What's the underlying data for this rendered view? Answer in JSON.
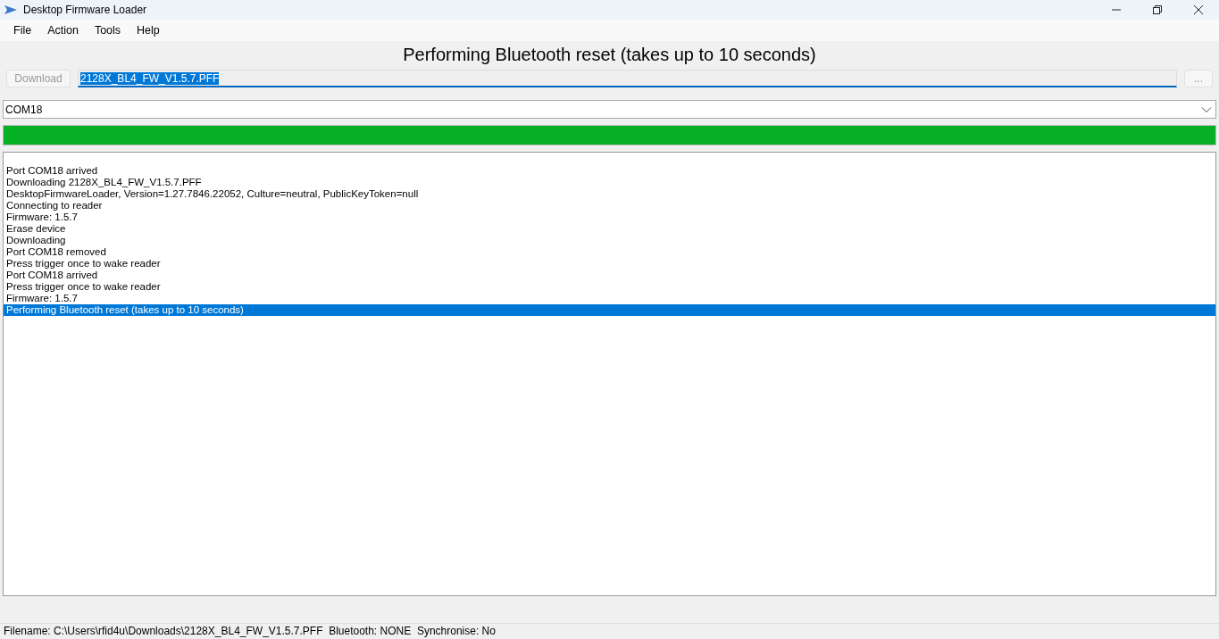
{
  "window": {
    "title": "Desktop Firmware Loader"
  },
  "menu": [
    "File",
    "Action",
    "Tools",
    "Help"
  ],
  "heading": "Performing Bluetooth reset (takes up to 10 seconds)",
  "download_button": {
    "label": "Download",
    "disabled": true
  },
  "filename_field": {
    "value": "2128X_BL4_FW_V1.5.7.PFF",
    "text_selected": true
  },
  "browse_button": {
    "label": "...",
    "disabled": true
  },
  "port_combo": {
    "value": "COM18"
  },
  "progress": {
    "level": 1.0
  },
  "log": [
    {
      "text": "Port COM18 arrived",
      "selected": false
    },
    {
      "text": "Downloading 2128X_BL4_FW_V1.5.7.PFF",
      "selected": false
    },
    {
      "text": "DesktopFirmwareLoader, Version=1.27.7846.22052, Culture=neutral, PublicKeyToken=null",
      "selected": false
    },
    {
      "text": "Connecting to reader",
      "selected": false
    },
    {
      "text": "Firmware: 1.5.7",
      "selected": false
    },
    {
      "text": "Erase device",
      "selected": false
    },
    {
      "text": "Downloading",
      "selected": false
    },
    {
      "text": "Port COM18 removed",
      "selected": false
    },
    {
      "text": "Press trigger once to wake reader",
      "selected": false
    },
    {
      "text": "Port COM18 arrived",
      "selected": false
    },
    {
      "text": "Press trigger once to wake reader",
      "selected": false
    },
    {
      "text": "Firmware: 1.5.7",
      "selected": false
    },
    {
      "text": "Performing Bluetooth reset (takes up to 10 seconds)",
      "selected": true
    }
  ],
  "status_bar": "Filename: C:\\Users\\rfid4u\\Downloads\\2128X_BL4_FW_V1.5.7.PFF  Bluetooth: NONE  Synchronise: No"
}
